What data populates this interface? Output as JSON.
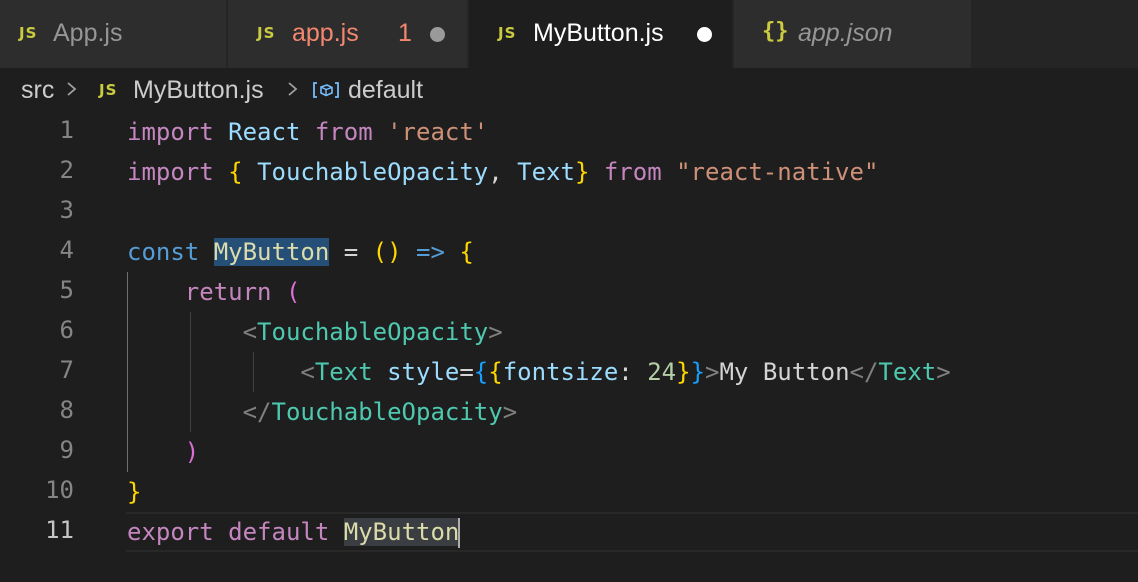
{
  "tabs": [
    {
      "icon": "JS",
      "label": "App.js",
      "state": "inactive"
    },
    {
      "icon": "JS",
      "label": "app.js",
      "state": "error",
      "problems": "1"
    },
    {
      "icon": "JS",
      "label": "MyButton.js",
      "state": "active-modified"
    },
    {
      "icon": "{}",
      "label": "app.json",
      "state": "preview"
    }
  ],
  "breadcrumb": {
    "folder": "src",
    "file_icon": "JS",
    "file": "MyButton.js",
    "symbol": "default"
  },
  "editor": {
    "current_line": 11,
    "lines": [
      {
        "n": "1",
        "tokens": [
          "import",
          "React",
          "from",
          "'react'"
        ]
      },
      {
        "n": "2",
        "tokens": [
          "import",
          "{",
          "TouchableOpacity",
          ",",
          "Text",
          "}",
          "from",
          "\"react-native\""
        ]
      },
      {
        "n": "3",
        "tokens": []
      },
      {
        "n": "4",
        "tokens": [
          "const",
          "MyButton",
          "=",
          "(",
          ")",
          "=>",
          "{"
        ]
      },
      {
        "n": "5",
        "tokens": [
          "return",
          "("
        ]
      },
      {
        "n": "6",
        "tokens": [
          "<",
          "TouchableOpacity",
          ">"
        ]
      },
      {
        "n": "7",
        "tokens": [
          "<",
          "Text",
          "style",
          "=",
          "{",
          "{",
          "fontsize",
          ":",
          "24",
          "}",
          "}",
          ">",
          "My Button",
          "</",
          "Text",
          ">"
        ]
      },
      {
        "n": "8",
        "tokens": [
          "</",
          "TouchableOpacity",
          ">"
        ]
      },
      {
        "n": "9",
        "tokens": [
          ")"
        ]
      },
      {
        "n": "10",
        "tokens": [
          "}"
        ]
      },
      {
        "n": "11",
        "tokens": [
          "export",
          "default",
          "MyButton"
        ]
      }
    ]
  },
  "colors": {
    "editor_bg": "#1e1e1e",
    "tab_bg": "#2d2d2d",
    "js_icon": "#cbcb41",
    "error": "#f48771",
    "keyword": "#c586c0",
    "storage": "#569cd6",
    "string": "#ce9178",
    "tag": "#4ec9b0",
    "variable": "#9cdcfe"
  },
  "icons": {
    "js_file": "js-file-icon",
    "json_file": "json-file-icon",
    "modified": "modified-dot-icon",
    "symbol": "symbol-variable-icon",
    "separator": "chevron-right-icon"
  }
}
